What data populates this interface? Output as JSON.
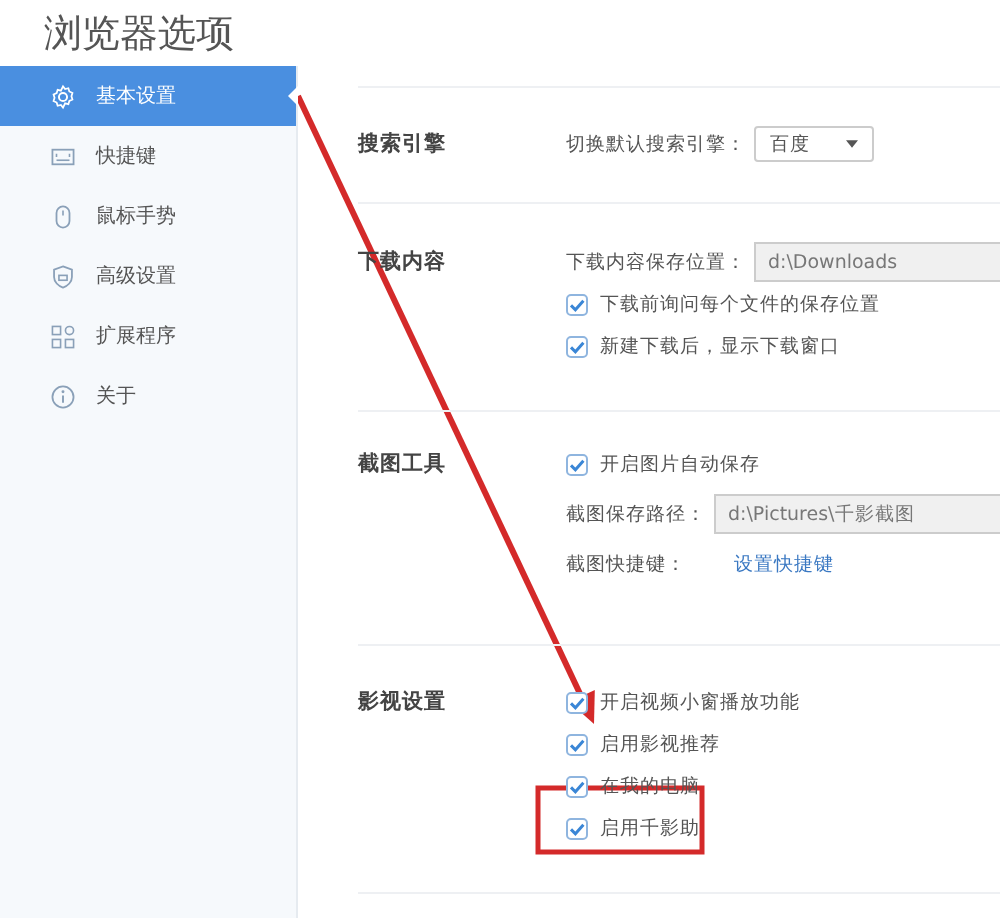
{
  "window": {
    "title": "浏览器选项"
  },
  "sidebar": {
    "items": [
      {
        "label": "基本设置",
        "selected": true
      },
      {
        "label": "快捷键",
        "selected": false
      },
      {
        "label": "鼠标手势",
        "selected": false
      },
      {
        "label": "高级设置",
        "selected": false
      },
      {
        "label": "扩展程序",
        "selected": false
      },
      {
        "label": "关于",
        "selected": false
      }
    ]
  },
  "sections": [
    {
      "title": "搜索引擎",
      "rows": [
        {
          "kind": "select",
          "label": "切换默认搜索引擎：",
          "value": "百度"
        }
      ]
    },
    {
      "title": "下载内容",
      "rows": [
        {
          "kind": "field",
          "label": "下载内容保存位置：",
          "value": "d:\\Downloads"
        },
        {
          "kind": "checkbox",
          "label": "下载前询问每个文件的保存位置",
          "checked": true
        },
        {
          "kind": "checkbox",
          "label": "新建下载后，显示下载窗口",
          "checked": true
        }
      ]
    },
    {
      "title": "截图工具",
      "rows": [
        {
          "kind": "checkbox",
          "label": "开启图片自动保存",
          "checked": true
        },
        {
          "kind": "field",
          "label": "截图保存路径：",
          "value": "d:\\Pictures\\千影截图"
        },
        {
          "kind": "link",
          "label": "截图快捷键：",
          "value": "设置快捷键"
        }
      ]
    },
    {
      "title": "影视设置",
      "rows": [
        {
          "kind": "checkbox",
          "label": "开启视频小窗播放功能",
          "checked": true
        },
        {
          "kind": "checkbox",
          "label": "启用影视推荐",
          "checked": true
        },
        {
          "kind": "checkbox",
          "label": "在我的电脑",
          "checked": true
        },
        {
          "kind": "checkbox",
          "label": "启用千影助",
          "checked": true
        }
      ]
    }
  ]
}
